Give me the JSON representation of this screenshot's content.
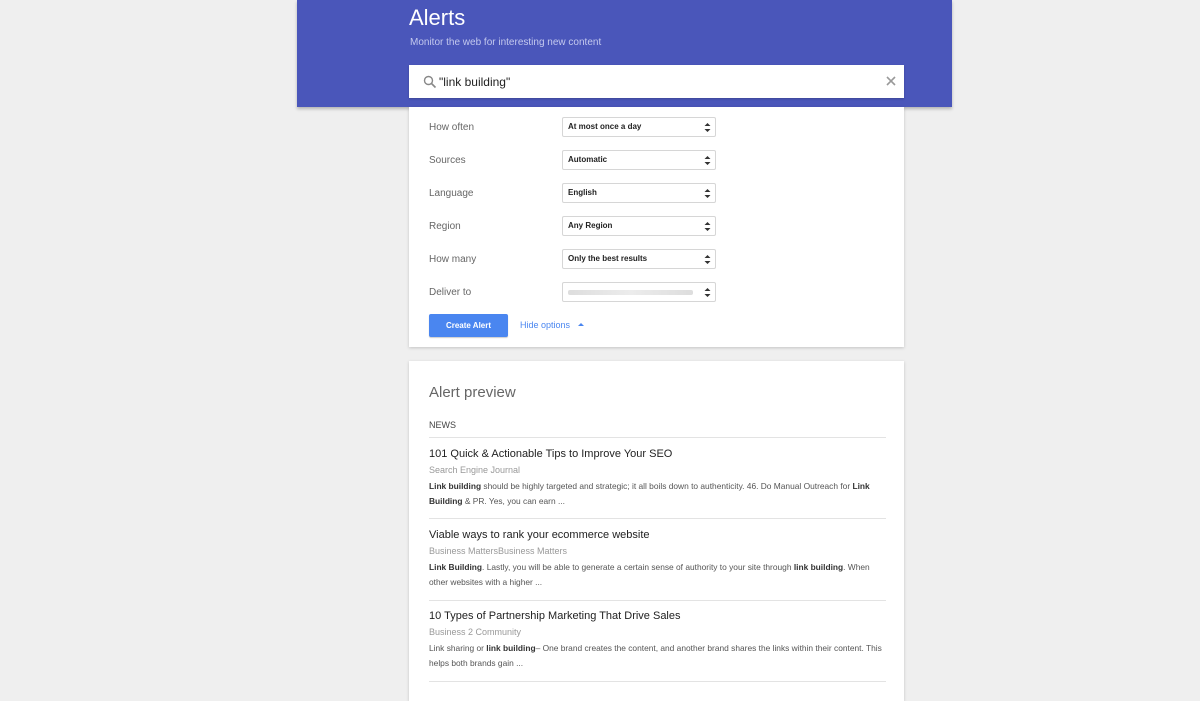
{
  "header": {
    "title": "Alerts",
    "subtitle": "Monitor the web for interesting new content",
    "accent": "#4a56ba"
  },
  "search": {
    "query": "\"link building\"",
    "search_icon": "search-icon",
    "clear_icon": "close-icon"
  },
  "options": {
    "rows": [
      {
        "label": "How often",
        "value": "At most once a day"
      },
      {
        "label": "Sources",
        "value": "Automatic"
      },
      {
        "label": "Language",
        "value": "English"
      },
      {
        "label": "Region",
        "value": "Any Region"
      },
      {
        "label": "How many",
        "value": "Only the best results"
      },
      {
        "label": "Deliver to",
        "value": ""
      }
    ],
    "create_label": "Create Alert",
    "hide_label": "Hide options",
    "button_color": "#4a86f0"
  },
  "preview": {
    "title": "Alert preview",
    "section": "NEWS",
    "articles": [
      {
        "title": "101 Quick & Actionable Tips to Improve Your SEO",
        "source": "Search Engine Journal",
        "snippet_parts": [
          {
            "t": "Link building",
            "b": true
          },
          {
            "t": " should be highly targeted and strategic; it all boils down to authenticity. 46. Do Manual Outreach for ",
            "b": false
          },
          {
            "t": "Link Building",
            "b": true
          },
          {
            "t": " & PR. Yes, you can earn ...",
            "b": false
          }
        ]
      },
      {
        "title": "Viable ways to rank your ecommerce website",
        "source": "Business MattersBusiness Matters",
        "snippet_parts": [
          {
            "t": "Link Building",
            "b": true
          },
          {
            "t": ". Lastly, you will be able to generate a certain sense of authority to your site through ",
            "b": false
          },
          {
            "t": "link building",
            "b": true
          },
          {
            "t": ". When other websites with a higher ...",
            "b": false
          }
        ]
      },
      {
        "title": "10 Types of Partnership Marketing That Drive Sales",
        "source": "Business 2 Community",
        "snippet_parts": [
          {
            "t": "Link sharing or ",
            "b": false
          },
          {
            "t": "link building",
            "b": true
          },
          {
            "t": "– One brand creates the content, and another brand shares the links within their content. This helps both brands gain ...",
            "b": false
          }
        ]
      }
    ]
  }
}
